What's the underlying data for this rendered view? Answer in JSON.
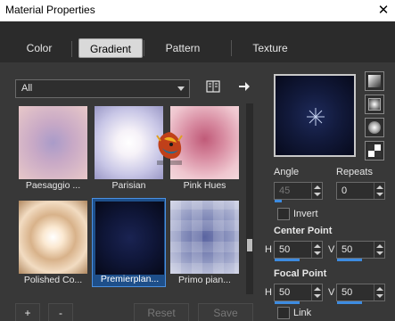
{
  "window": {
    "title": "Material Properties",
    "close_glyph": "✕"
  },
  "tabs": [
    {
      "label": "Color"
    },
    {
      "label": "Gradient"
    },
    {
      "label": "Pattern"
    },
    {
      "label": "Texture"
    }
  ],
  "category": {
    "selected": "All"
  },
  "swatches": [
    {
      "label": "Paesaggio ..."
    },
    {
      "label": "Parisian"
    },
    {
      "label": "Pink Hues"
    },
    {
      "label": "Polished Co..."
    },
    {
      "label": "Premierplan..."
    },
    {
      "label": "Primo pian..."
    }
  ],
  "controls": {
    "angle_label": "Angle",
    "angle_value": "45",
    "repeats_label": "Repeats",
    "repeats_value": "0",
    "invert_label": "Invert",
    "center_point_label": "Center Point",
    "focal_point_label": "Focal Point",
    "h_label": "H",
    "v_label": "V",
    "center_h": "50",
    "center_v": "50",
    "focal_h": "50",
    "focal_v": "50",
    "link_label": "Link"
  },
  "buttons": {
    "add": "+",
    "remove": "-",
    "reset": "Reset",
    "save": "Save"
  },
  "colors": {
    "accent": "#3d8be0",
    "selected_bg": "#1e4f8a"
  }
}
